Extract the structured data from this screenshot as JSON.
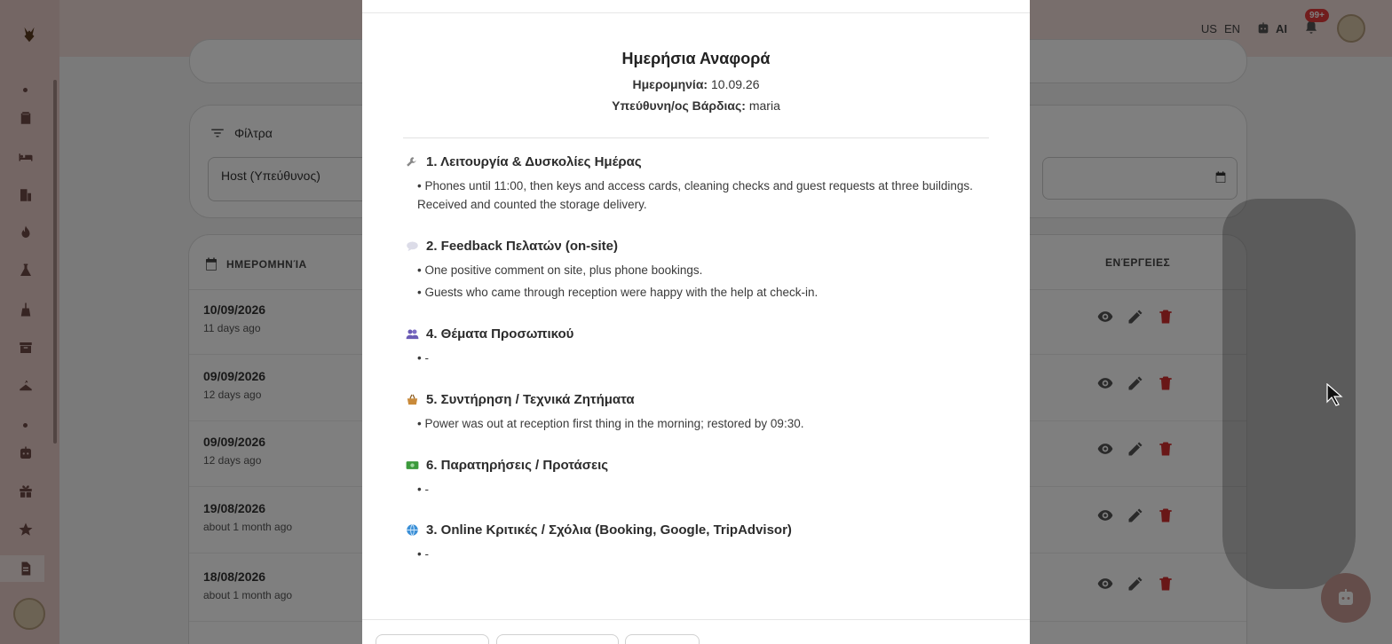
{
  "topbar": {
    "lang_flag": "US",
    "lang_code": "EN",
    "ai_label": "AI",
    "notif_badge": "99+"
  },
  "filters": {
    "title": "Φίλτρα",
    "host_value": "Host (Υπεύθυνος)"
  },
  "table": {
    "col_date": "ΗΜΕΡΟΜΗΝΊΑ",
    "col_actions": "ΕΝΈΡΓΕΙΕΣ",
    "rows": [
      {
        "date": "10/09/2026",
        "relative": "11 days ago"
      },
      {
        "date": "09/09/2026",
        "relative": "12 days ago"
      },
      {
        "date": "09/09/2026",
        "relative": "12 days ago"
      },
      {
        "date": "19/08/2026",
        "relative": "about 1 month ago"
      },
      {
        "date": "18/08/2026",
        "relative": "about 1 month ago"
      }
    ]
  },
  "modal": {
    "title": "Ημερήσια Αναφορά",
    "date_label": "Ημερομηνία:",
    "date_value": "10.09.26",
    "shift_label": "Υπεύθυνη/ος Βάρδιας:",
    "shift_value": "maria",
    "sections": [
      {
        "icon": "wrench-icon",
        "title": "1. Λειτουργία & Δυσκολίες Ημέρας",
        "items": [
          "Phones until 11:00, then keys and access cards, cleaning checks and guest requests at three buildings. Received and counted the storage delivery."
        ]
      },
      {
        "icon": "speech-bubble-icon",
        "title": "2. Feedback Πελατών (on-site)",
        "items": [
          "One positive comment on site, plus phone bookings.",
          "Guests who came through reception were happy with the help at check-in."
        ]
      },
      {
        "icon": "people-icon",
        "title": "4. Θέματα Προσωπικού",
        "items": [
          "-"
        ]
      },
      {
        "icon": "basket-icon",
        "title": "5. Συντήρηση / Τεχνικά Ζητήματα",
        "items": [
          "Power was out at reception first thing in the morning; restored by 09:30."
        ]
      },
      {
        "icon": "money-icon",
        "title": "6. Παρατηρήσεις / Προτάσεις",
        "items": [
          "-"
        ]
      },
      {
        "icon": "globe-icon",
        "title": "3. Online Κριτικές / Σχόλια (Booking, Google, TripAdvisor)",
        "items": [
          "-"
        ]
      }
    ]
  },
  "colors": {
    "accent": "#c99a94",
    "danger": "#d32f2f",
    "sidebar": "#e8ccc8"
  }
}
